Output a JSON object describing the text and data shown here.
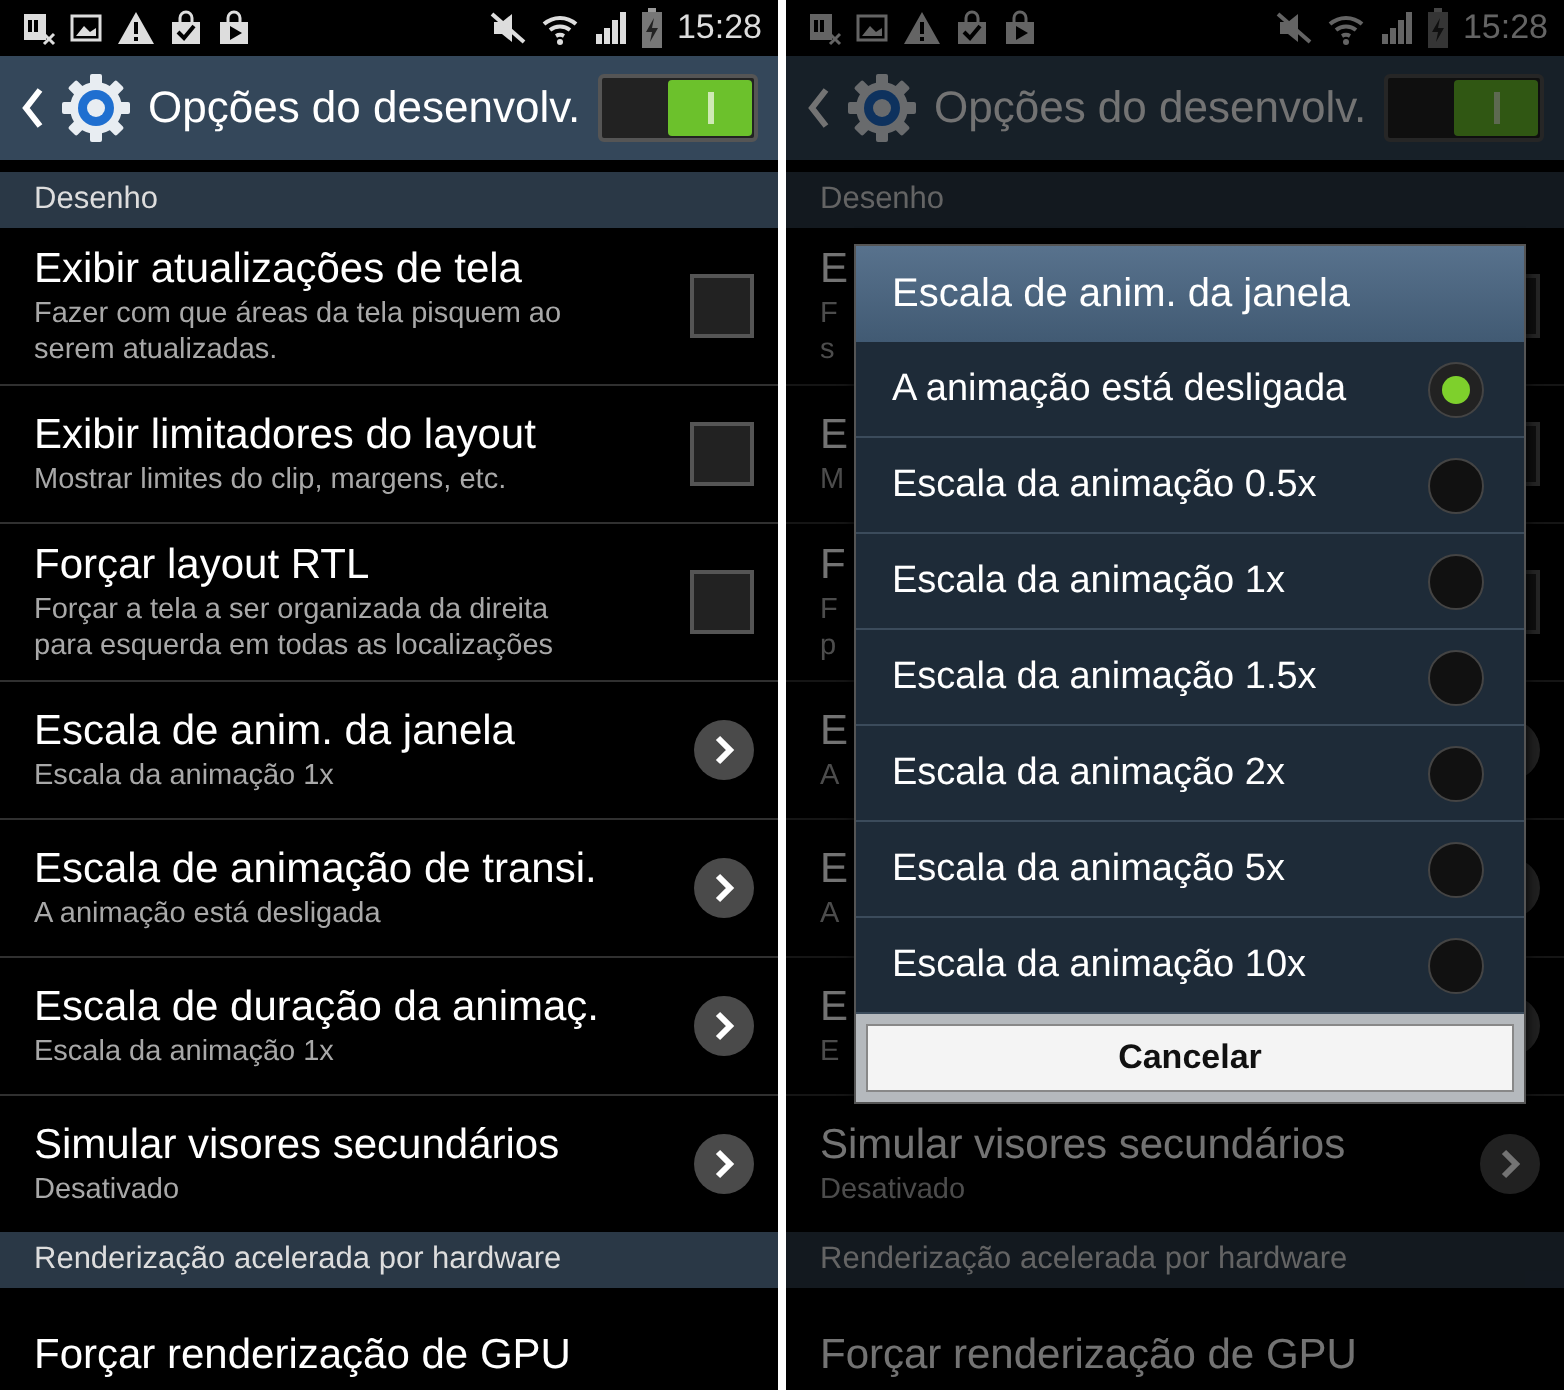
{
  "screens": [
    {
      "status_bar": {
        "time": "15:28"
      },
      "header": {
        "title": "Opções do desenvolv.",
        "switch_on": true
      },
      "sections": [
        {
          "title": "Desenho",
          "items": [
            {
              "kind": "checkbox",
              "title": "Exibir atualizações de tela",
              "subtitle": "Fazer com que áreas da tela pisquem ao serem atualizadas.",
              "checked": false
            },
            {
              "kind": "checkbox",
              "title": "Exibir limitadores do layout",
              "subtitle": "Mostrar limites do clip, margens, etc.",
              "checked": false
            },
            {
              "kind": "checkbox",
              "title": "Forçar layout RTL",
              "subtitle": "Forçar a tela a ser organizada da direita para esquerda em todas as localizações",
              "checked": false
            },
            {
              "kind": "chevron",
              "title": "Escala de anim. da janela",
              "subtitle": "Escala da animação 1x"
            },
            {
              "kind": "chevron",
              "title": "Escala de animação de transi.",
              "subtitle": "A animação está desligada"
            },
            {
              "kind": "chevron",
              "title": "Escala de duração da animaç.",
              "subtitle": "Escala da animação 1x"
            },
            {
              "kind": "chevron",
              "title": "Simular visores secundários",
              "subtitle": "Desativado"
            }
          ]
        },
        {
          "title": "Renderização acelerada por hardware",
          "items": [
            {
              "kind": "plain",
              "title": "Forçar renderização de GPU"
            }
          ]
        }
      ]
    },
    {
      "status_bar": {
        "time": "15:28"
      },
      "header": {
        "title": "Opções do desenvolv.",
        "switch_on": true
      },
      "sections": [
        {
          "title": "Desenho",
          "items": [
            {
              "kind": "checkbox",
              "title": "E",
              "subtitle": "F\ns",
              "checked": false
            },
            {
              "kind": "checkbox",
              "title": "E",
              "subtitle": "M",
              "checked": false
            },
            {
              "kind": "checkbox",
              "title": "F",
              "subtitle": "F\np",
              "checked": false
            },
            {
              "kind": "chevron",
              "title": "E",
              "subtitle": "A"
            },
            {
              "kind": "chevron",
              "title": "E",
              "subtitle": "A"
            },
            {
              "kind": "chevron",
              "title": "E",
              "subtitle": "E"
            },
            {
              "kind": "chevron",
              "title": "Simular visores secundários",
              "subtitle": "Desativado"
            }
          ]
        },
        {
          "title": "Renderização acelerada por hardware",
          "items": [
            {
              "kind": "plain",
              "title": "Forçar renderização de GPU"
            }
          ]
        }
      ],
      "dialog": {
        "title": "Escala de anim. da janela",
        "options": [
          {
            "label": "A animação está desligada",
            "selected": true
          },
          {
            "label": "Escala da animação 0.5x",
            "selected": false
          },
          {
            "label": "Escala da animação 1x",
            "selected": false
          },
          {
            "label": "Escala da animação 1.5x",
            "selected": false
          },
          {
            "label": "Escala da animação 2x",
            "selected": false
          },
          {
            "label": "Escala da animação 5x",
            "selected": false
          },
          {
            "label": "Escala da animação 10x",
            "selected": false
          }
        ],
        "cancel": "Cancelar"
      }
    }
  ]
}
